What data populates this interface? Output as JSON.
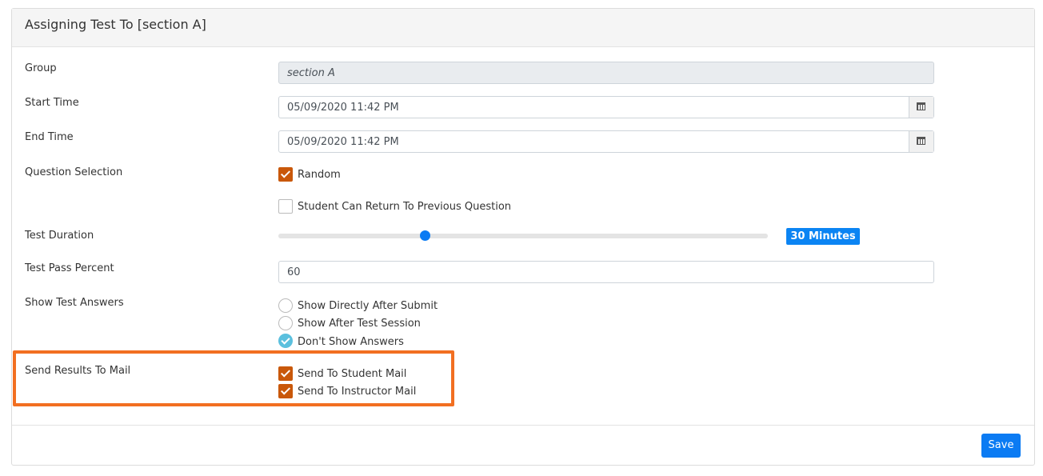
{
  "header": {
    "title": "Assigning Test To [section A]"
  },
  "form": {
    "group": {
      "label": "Group",
      "value": "section A"
    },
    "start_time": {
      "label": "Start Time",
      "value": "05/09/2020 11:42 PM"
    },
    "end_time": {
      "label": "End Time",
      "value": "05/09/2020 11:42 PM"
    },
    "question_selection": {
      "label": "Question Selection",
      "options": [
        {
          "label": "Random",
          "checked": true
        },
        {
          "label": "Student Can Return To Previous Question",
          "checked": false
        }
      ]
    },
    "test_duration": {
      "label": "Test Duration",
      "value_label": "30 Minutes",
      "slider_fraction": 0.3
    },
    "pass_percent": {
      "label": "Test Pass Percent",
      "value": "60"
    },
    "show_answers": {
      "label": "Show Test Answers",
      "options": [
        {
          "label": "Show Directly After Submit",
          "selected": false
        },
        {
          "label": "Show After Test Session",
          "selected": false
        },
        {
          "label": "Don't Show Answers",
          "selected": true
        }
      ]
    },
    "send_results": {
      "label": "Send Results To Mail",
      "options": [
        {
          "label": "Send To Student Mail",
          "checked": true
        },
        {
          "label": "Send To Instructor Mail",
          "checked": true
        }
      ]
    }
  },
  "footer": {
    "save_label": "Save"
  },
  "colors": {
    "accent": "#0b7bf3",
    "checkbox": "#c9580a",
    "radio_selected": "#5bc0de",
    "highlight": "#f26f21"
  }
}
